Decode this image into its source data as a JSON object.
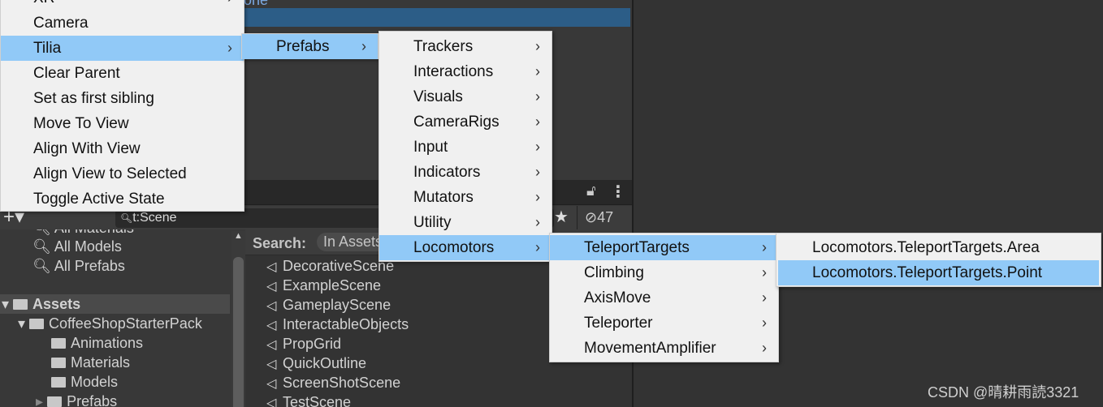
{
  "hierarchy": {
    "partial_text": "one"
  },
  "project": {
    "search_value": "t:Scene",
    "hidden_count": "47",
    "search_label": "Search:",
    "search_scope": "In Assets",
    "favorites": [
      "All Materials",
      "All Models",
      "All Prefabs"
    ],
    "tree": {
      "root": "Assets",
      "child": "CoffeeShopStarterPack",
      "folders": [
        "Animations",
        "Materials",
        "Models",
        "Prefabs"
      ]
    },
    "results": [
      "DecorativeScene",
      "ExampleScene",
      "GameplayScene",
      "InteractableObjects",
      "PropGrid",
      "QuickOutline",
      "ScreenShotScene",
      "TestScene"
    ]
  },
  "menu1": {
    "items": [
      "XR",
      "Camera",
      "Tilia",
      "Clear Parent",
      "Set as first sibling",
      "Move To View",
      "Align With View",
      "Align View to Selected",
      "Toggle Active State"
    ],
    "highlighted": "Tilia"
  },
  "menu2": {
    "items": [
      "Prefabs"
    ]
  },
  "menu3": {
    "items": [
      "Trackers",
      "Interactions",
      "Visuals",
      "CameraRigs",
      "Input",
      "Indicators",
      "Mutators",
      "Utility",
      "Locomotors"
    ],
    "highlighted": "Locomotors"
  },
  "menu4": {
    "items": [
      "TeleportTargets",
      "Climbing",
      "AxisMove",
      "Teleporter",
      "MovementAmplifier"
    ],
    "highlighted": "TeleportTargets"
  },
  "menu5": {
    "items": [
      "Locomotors.TeleportTargets.Area",
      "Locomotors.TeleportTargets.Point"
    ],
    "highlighted": "Locomotors.TeleportTargets.Point"
  },
  "watermark": "CSDN @晴耕雨読3321",
  "colors": {
    "highlight": "#91c9f7",
    "selection": "#2c5d87"
  }
}
